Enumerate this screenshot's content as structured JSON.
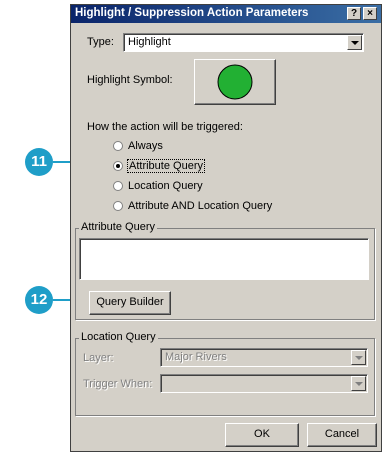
{
  "dialog": {
    "title": "Highlight / Suppression Action Parameters",
    "help_button": "?",
    "close_button": "×"
  },
  "type": {
    "label": "Type:",
    "value": "Highlight"
  },
  "highlight_symbol": {
    "label": "Highlight Symbol:",
    "color": "#22b033"
  },
  "trigger": {
    "heading": "How the action will be triggered:",
    "options": [
      "Always",
      "Attribute Query",
      "Location Query",
      "Attribute AND Location Query"
    ],
    "selected": "Attribute Query"
  },
  "attribute_query": {
    "label": "Attribute Query",
    "text": "",
    "builder_button": "Query Builder"
  },
  "location_query": {
    "label": "Location Query",
    "layer_label": "Layer:",
    "layer_value": "Major Rivers",
    "trigger_label": "Trigger When:",
    "trigger_value": ""
  },
  "footer": {
    "ok": "OK",
    "cancel": "Cancel"
  },
  "callouts": {
    "step_11": "11",
    "step_12": "12"
  },
  "colors": {
    "callout": "#1f9ec8",
    "titlebar": "#0a246a"
  }
}
